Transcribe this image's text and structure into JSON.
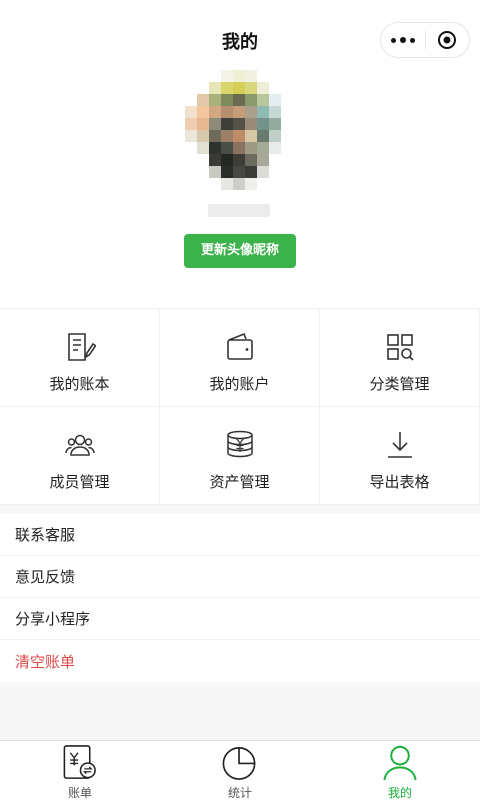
{
  "header": {
    "title": "我的",
    "update_button": "更新头像昵称"
  },
  "grid": [
    {
      "label": "我的账本",
      "icon": "ledger-icon"
    },
    {
      "label": "我的账户",
      "icon": "wallet-icon"
    },
    {
      "label": "分类管理",
      "icon": "category-icon"
    },
    {
      "label": "成员管理",
      "icon": "members-icon"
    },
    {
      "label": "资产管理",
      "icon": "assets-icon"
    },
    {
      "label": "导出表格",
      "icon": "export-icon"
    }
  ],
  "menu": [
    {
      "label": "联系客服"
    },
    {
      "label": "意见反馈"
    },
    {
      "label": "分享小程序"
    },
    {
      "label": "清空账单",
      "color": "#e04a4a"
    }
  ],
  "tabs": [
    {
      "label": "账单",
      "icon": "bill-icon"
    },
    {
      "label": "统计",
      "icon": "chart-icon"
    },
    {
      "label": "我的",
      "icon": "profile-icon",
      "active": true
    }
  ],
  "colors": {
    "accent": "#3cb34a",
    "active_tab": "#18b03a",
    "danger": "#e04a4a"
  }
}
